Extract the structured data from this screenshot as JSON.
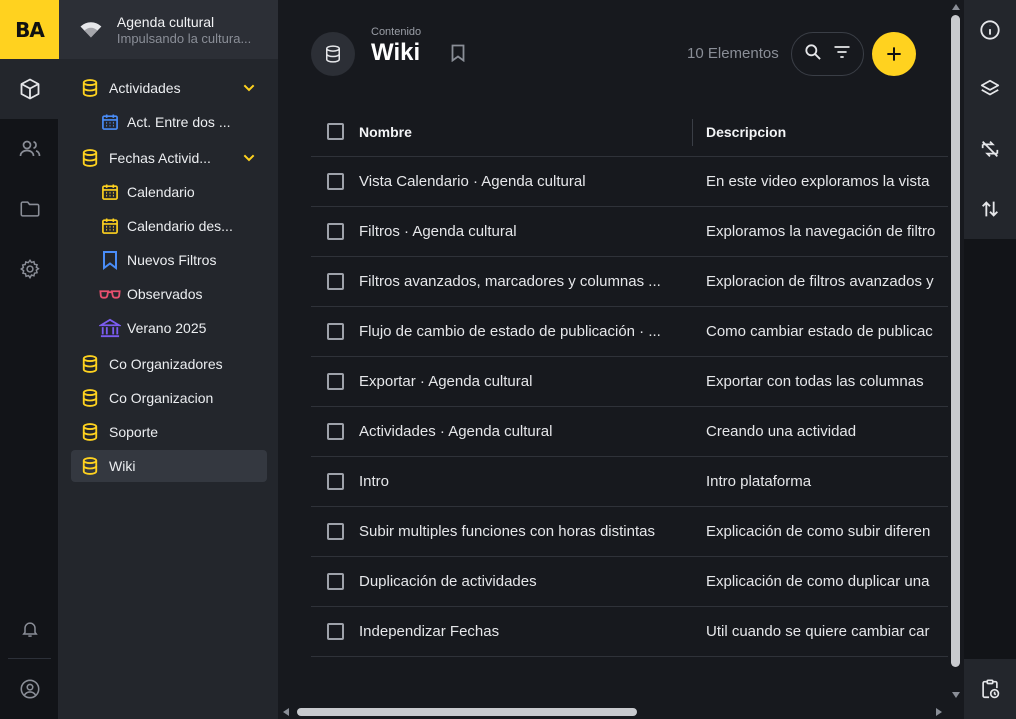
{
  "brand": {
    "logo_text": "BA",
    "accent": "#ffd21f"
  },
  "rail": {
    "items": [
      {
        "name": "box-icon",
        "active": true
      },
      {
        "name": "users-icon"
      },
      {
        "name": "folder-icon"
      },
      {
        "name": "gear-icon"
      }
    ],
    "bottom": [
      {
        "name": "bell-icon"
      },
      {
        "name": "user-circle-icon"
      }
    ]
  },
  "workspace": {
    "title": "Agenda cultural",
    "subtitle": "Impulsando la cultura..."
  },
  "sidebar": {
    "items": [
      {
        "label": "Actividades",
        "icon": "database-icon",
        "level": 0,
        "expanded": true
      },
      {
        "label": "Act. Entre dos ...",
        "icon": "calendar-icon",
        "level": 1,
        "color": "#4a8df8"
      },
      {
        "label": "Fechas Activid...",
        "icon": "database-icon",
        "level": 0,
        "expanded": true
      },
      {
        "label": "Calendario",
        "icon": "calendar-icon",
        "level": 1,
        "color": "#ffd21f"
      },
      {
        "label": "Calendario des...",
        "icon": "calendar-icon",
        "level": 1,
        "color": "#ffd21f"
      },
      {
        "label": "Nuevos Filtros",
        "icon": "bookmark-icon",
        "level": 1,
        "color": "#4a8df8"
      },
      {
        "label": "Observados",
        "icon": "glasses-icon",
        "level": 1,
        "color": "#e8506e"
      },
      {
        "label": "Verano 2025",
        "icon": "museum-icon",
        "level": 1,
        "color": "#7b5cf0"
      },
      {
        "label": "Co Organizadores",
        "icon": "database-icon",
        "level": 0
      },
      {
        "label": "Co Organizacion",
        "icon": "database-icon",
        "level": 0
      },
      {
        "label": "Soporte",
        "icon": "database-icon",
        "level": 0
      },
      {
        "label": "Wiki",
        "icon": "database-icon",
        "level": 0,
        "active": true
      }
    ]
  },
  "header": {
    "breadcrumb": "Contenido",
    "title": "Wiki",
    "count_label": "10 Elementos"
  },
  "table": {
    "columns": [
      "Nombre",
      "Descripcion"
    ],
    "rows": [
      {
        "nombre": "Vista Calendario · Agenda cultural",
        "descripcion": "En este video exploramos la vista"
      },
      {
        "nombre": "Filtros · Agenda cultural",
        "descripcion": "Exploramos la navegación de filtro"
      },
      {
        "nombre": "Filtros avanzados, marcadores y columnas ...",
        "descripcion": "Exploracion de filtros avanzados y"
      },
      {
        "nombre": "Flujo de cambio de estado de publicación · ...",
        "descripcion": "Como cambiar estado de publicac"
      },
      {
        "nombre": "Exportar · Agenda cultural",
        "descripcion": "Exportar con todas las columnas"
      },
      {
        "nombre": "Actividades · Agenda cultural",
        "descripcion": "Creando una actividad"
      },
      {
        "nombre": "Intro",
        "descripcion": "Intro plataforma"
      },
      {
        "nombre": "Subir multiples funciones con horas distintas",
        "descripcion": "Explicación de como subir diferen"
      },
      {
        "nombre": "Duplicación de actividades",
        "descripcion": "Explicación de como duplicar una"
      },
      {
        "nombre": "Independizar Fechas",
        "descripcion": "Util cuando se quiere cambiar car"
      }
    ]
  },
  "right_rail": {
    "items": [
      {
        "name": "info-icon"
      },
      {
        "name": "layers-icon"
      },
      {
        "name": "sync-off-icon"
      },
      {
        "name": "sort-arrows-icon"
      }
    ],
    "bottom": {
      "name": "clipboard-clock-icon"
    }
  }
}
